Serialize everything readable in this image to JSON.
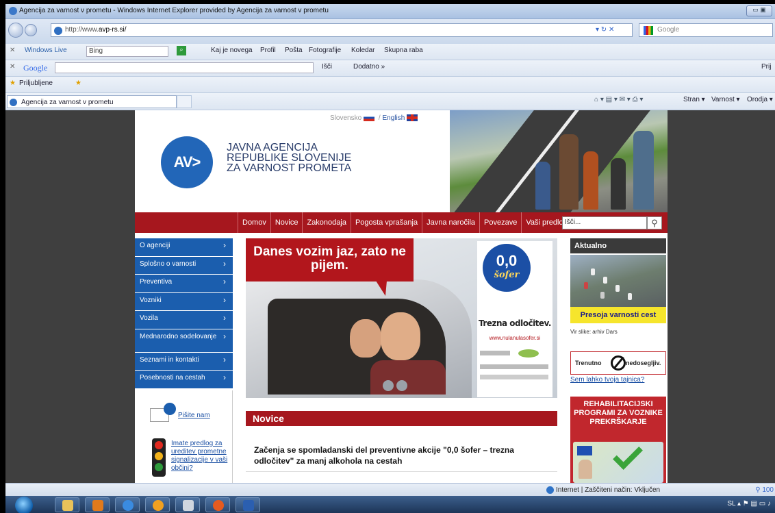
{
  "window": {
    "title": "Agencija za varnost v prometu - Windows Internet Explorer provided by Agencija za varnost v prometu"
  },
  "address_bar": {
    "url_prefix": "http://www.",
    "url_domain": "avp-rs.si/",
    "search_provider": "Google"
  },
  "windows_live_bar": {
    "label": "Windows Live",
    "search_value": "Bing",
    "links": [
      "Kaj je novega",
      "Profil",
      "Pošta",
      "Fotografije",
      "Koledar",
      "Skupna raba"
    ]
  },
  "google_bar": {
    "label": "Google",
    "go_label": "Išči",
    "more_label": "Dodatno »",
    "right_label": "Prij"
  },
  "favorites_bar": {
    "label": "Priljubljene"
  },
  "tab": {
    "label": "Agencija za varnost v prometu"
  },
  "command_bar": {
    "items": [
      "Stran ▾",
      "Varnost ▾",
      "Orodja ▾"
    ]
  },
  "site": {
    "lang_sl": "Slovensko",
    "lang_en": "English",
    "logo_text": "AV>",
    "agency_name": "JAVNA AGENCIJA\nREPUBLIKE SLOVENIJE\nZA VARNOST PROMETA",
    "topnav": [
      "Domov",
      "Novice",
      "Zakonodaja",
      "Pogosta vprašanja",
      "Javna naročila",
      "Povezave",
      "Vaši predlogi"
    ],
    "search_placeholder": "Išči...",
    "sidenav": [
      "O agenciji",
      "Splošno o varnosti",
      "Preventiva",
      "Vozniki",
      "Vozila",
      "Mednarodno sodelovanje",
      "Seznami in kontakti",
      "Posebnosti na cestah"
    ],
    "pisite": "Pišite nam",
    "predlog": "Imate predlog za ureditev prometne signalizacije v vaši občini?",
    "banner": {
      "headline": "Danes vozim jaz, zato ne pijem.",
      "sofer_number": "0,0",
      "sofer_word": "šofer",
      "tagline": "Trezna odločitev.",
      "link": "www.nulanulasofer.si"
    },
    "novice_header": "Novice",
    "news_headline": "Začenja se spomladanski del preventivne akcije \"0,0 šofer – trezna odločitev\" za manj alkohola na cestah",
    "aktualno": "Aktualno",
    "presoja": "Presoja varnosti cest",
    "vir": "Vir slike: arhiv Dars",
    "trenutno_left": "Trenutno",
    "trenutno_right": "nedosegljiv.",
    "tajnica": "Sem lahko tvoja tajnica?",
    "rehab": "REHABILITACIJSKI PROGRAMI ZA VOZNIKE PREKRŠKARJE"
  },
  "status_bar": {
    "zone": "Internet | Zaščiteni način: Vključen",
    "zoom": "100"
  },
  "taskbar": {
    "lang": "SL"
  },
  "colors": {
    "brand_red": "#a6171e",
    "brand_blue": "#1b5eae",
    "highlight_yellow": "#f6e52c"
  }
}
